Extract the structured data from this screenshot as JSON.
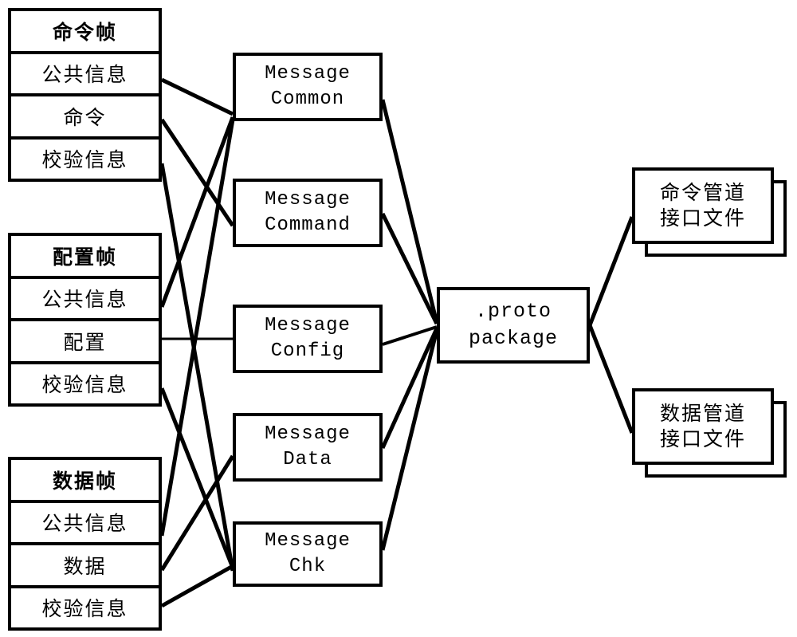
{
  "diagram": {
    "title": "Protocol frame structures mapped to .proto package and interface files",
    "line_color": "#000000",
    "box_border_color": "#000000",
    "background_color": "#ffffff"
  },
  "frames": [
    {
      "id": "command-frame",
      "header": "命令帧",
      "rows": [
        "公共信息",
        "命令",
        "校验信息"
      ]
    },
    {
      "id": "config-frame",
      "header": "配置帧",
      "rows": [
        "公共信息",
        "配置",
        "校验信息"
      ]
    },
    {
      "id": "data-frame",
      "header": "数据帧",
      "rows": [
        "公共信息",
        "数据",
        "校验信息"
      ]
    }
  ],
  "messages": [
    {
      "id": "message-common",
      "line1": "Message",
      "line2": "Common"
    },
    {
      "id": "message-command",
      "line1": "Message",
      "line2": "Command"
    },
    {
      "id": "message-config",
      "line1": "Message",
      "line2": "Config"
    },
    {
      "id": "message-data",
      "line1": "Message",
      "line2": "Data"
    },
    {
      "id": "message-chk",
      "line1": "Message",
      "line2": "Chk"
    }
  ],
  "package": {
    "id": "proto-package",
    "line1": ".proto",
    "line2": "package"
  },
  "outputs": [
    {
      "id": "command-pipe-interface-file",
      "line1": "命令管道",
      "line2": "接口文件"
    },
    {
      "id": "data-pipe-interface-file",
      "line1": "数据管道",
      "line2": "接口文件"
    }
  ],
  "connections": {
    "frames_to_messages": [
      {
        "from": "command-frame.公共信息",
        "to": "message-common"
      },
      {
        "from": "command-frame.命令",
        "to": "message-command"
      },
      {
        "from": "command-frame.校验信息",
        "to": "message-chk"
      },
      {
        "from": "config-frame.公共信息",
        "to": "message-common"
      },
      {
        "from": "config-frame.配置",
        "to": "message-config"
      },
      {
        "from": "config-frame.校验信息",
        "to": "message-chk"
      },
      {
        "from": "data-frame.公共信息",
        "to": "message-common"
      },
      {
        "from": "data-frame.数据",
        "to": "message-data"
      },
      {
        "from": "data-frame.校验信息",
        "to": "message-chk"
      }
    ],
    "messages_to_package": [
      {
        "from": "message-common",
        "to": "proto-package"
      },
      {
        "from": "message-command",
        "to": "proto-package"
      },
      {
        "from": "message-config",
        "to": "proto-package"
      },
      {
        "from": "message-data",
        "to": "proto-package"
      },
      {
        "from": "message-chk",
        "to": "proto-package"
      }
    ],
    "package_to_outputs": [
      {
        "from": "proto-package",
        "to": "command-pipe-interface-file"
      },
      {
        "from": "proto-package",
        "to": "data-pipe-interface-file"
      }
    ]
  }
}
